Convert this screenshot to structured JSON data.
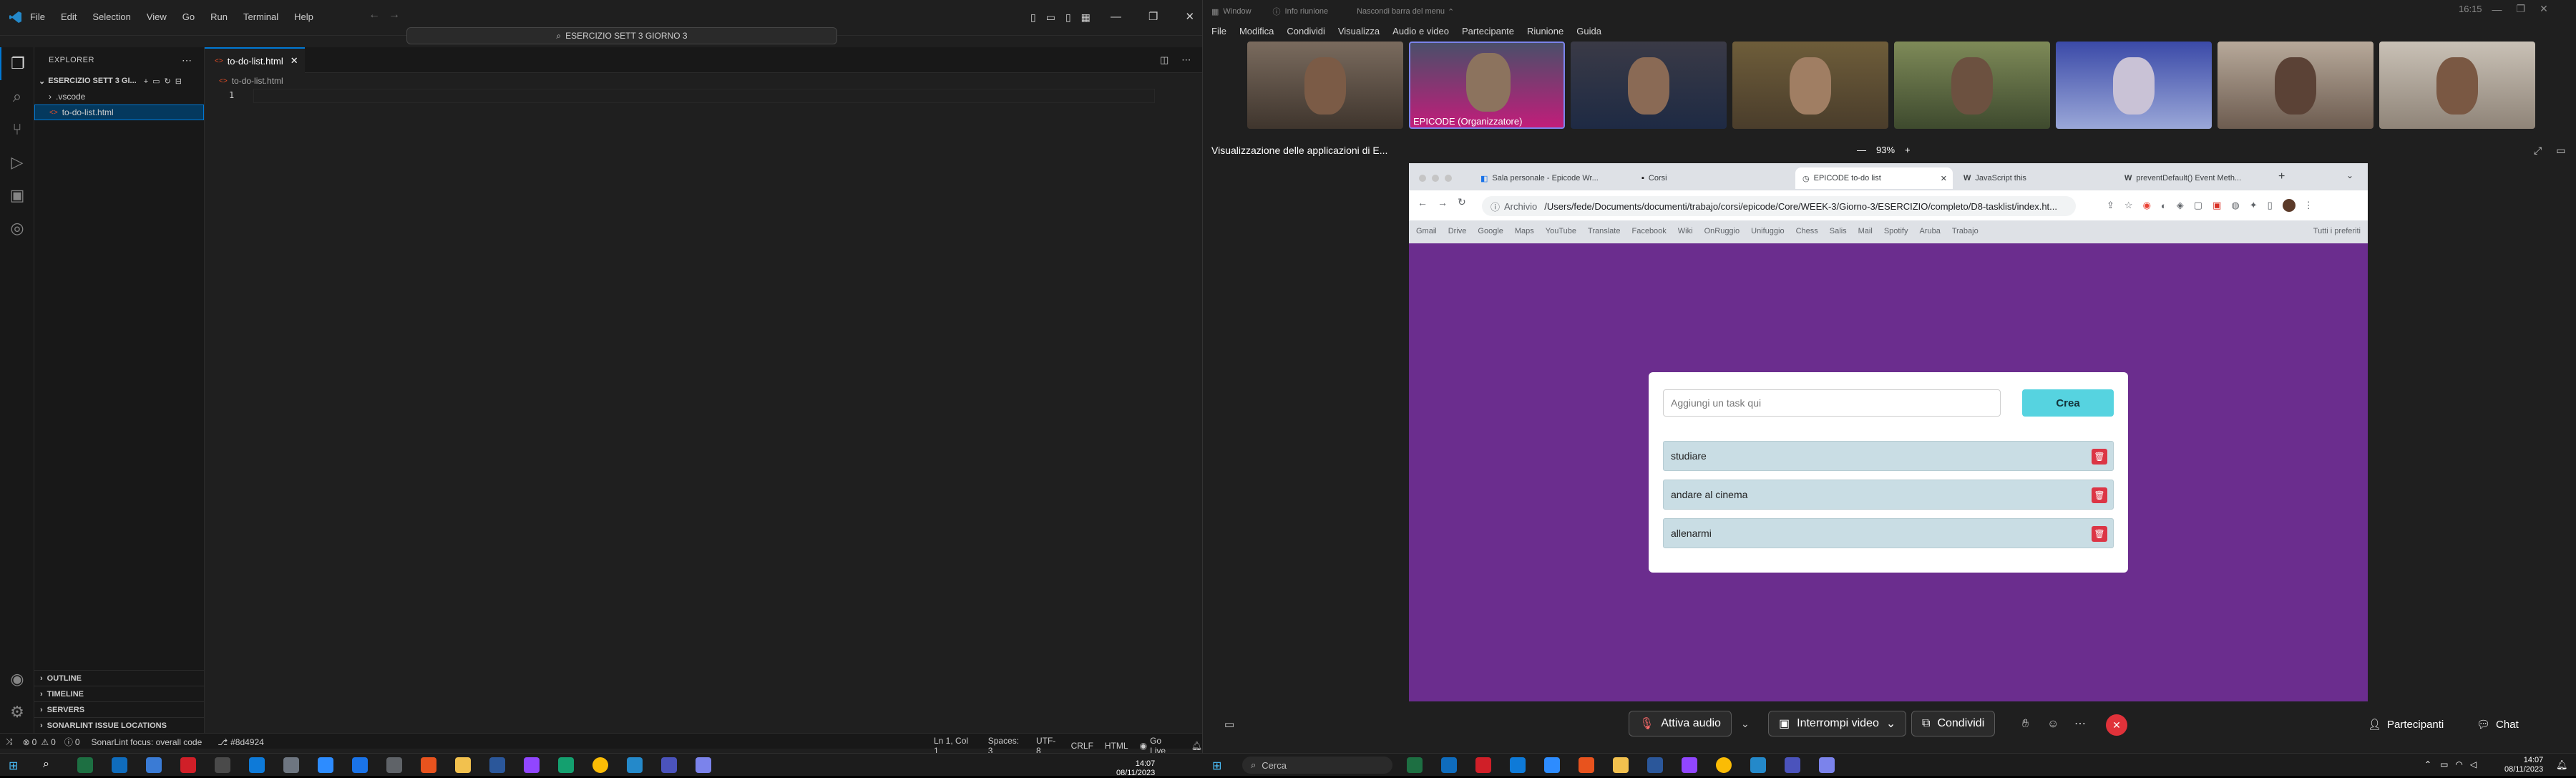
{
  "vscode": {
    "menu": [
      "File",
      "Edit",
      "Selection",
      "View",
      "Go",
      "Run",
      "Terminal",
      "Help"
    ],
    "search": "ESERCIZIO SETT 3 GIORNO 3",
    "explorer_title": "EXPLORER",
    "folder_name": "ESERCIZIO SETT 3 GI...",
    "tree": [
      ".vscode",
      "to-do-list.html"
    ],
    "tab_label": "to-do-list.html",
    "breadcrumb": "to-do-list.html",
    "line_number": "1",
    "sections": [
      "OUTLINE",
      "TIMELINE",
      "SERVERS",
      "SONARLINT ISSUE LOCATIONS"
    ],
    "status": {
      "errors": "0",
      "warnings": "0",
      "info": "0",
      "sonarlint": "SonarLint focus: overall code",
      "git": "#8d4924",
      "position": "Ln 1, Col 1",
      "spaces": "Spaces: 3",
      "encoding": "UTF-8",
      "eol": "CRLF",
      "language": "HTML",
      "golive": "Go Live"
    }
  },
  "teams": {
    "window_label": "Window",
    "meeting_info": "Info riunione",
    "hide_menu": "Nascondi barra del menu",
    "clock": "16:15",
    "menu": [
      "File",
      "Modifica",
      "Condividi",
      "Visualizza",
      "Audio e video",
      "Partecipante",
      "Riunione",
      "Guida"
    ],
    "organizer": "EPICODE (Organizzatore)",
    "share_title": "Visualizzazione delle applicazioni di E...",
    "zoom": "93%",
    "bottom": {
      "audio": "Attiva audio",
      "video": "Interrompi video",
      "share": "Condividi",
      "participants": "Partecipanti",
      "chat": "Chat"
    }
  },
  "chrome": {
    "tabs": [
      "Sala personale - Epicode Wr...",
      "Corsi",
      "EPICODE to-do list",
      "JavaScript this",
      "preventDefault() Event Meth..."
    ],
    "archive": "Archivio",
    "url": "/Users/fede/Documents/documenti/trabajo/corsi/epicode/Core/WEEK-3/Giorno-3/ESERCIZIO/completo/D8-tasklist/index.ht...",
    "bookmarks": [
      "Gmail",
      "Drive",
      "Google",
      "Maps",
      "YouTube",
      "Translate",
      "Facebook",
      "Wiki",
      "OnRuggio",
      "Unifuggio",
      "Chess",
      "Salis",
      "Mail",
      "Spotify",
      "Aruba",
      "Trabajo"
    ],
    "all_bookmarks": "Tutti i preferiti"
  },
  "todo": {
    "placeholder": "Aggiungi un task qui",
    "create": "Crea",
    "items": [
      "studiare",
      "andare al cinema",
      "allenarmi"
    ]
  },
  "taskbar": {
    "search": "Cerca",
    "time": "14:07",
    "date": "08/11/2023"
  }
}
